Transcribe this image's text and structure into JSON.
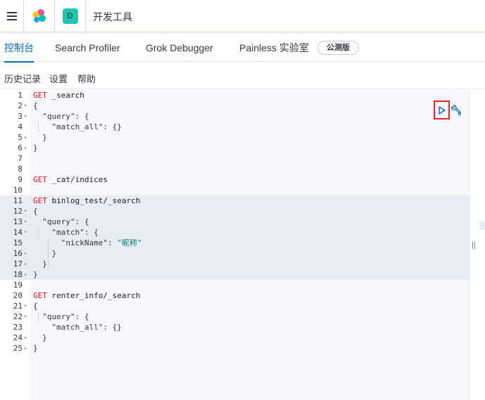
{
  "header": {
    "app_title": "开发工具",
    "space_initial": "D",
    "menu_icon": "hamburger-icon",
    "logo_icon": "elastic-logo-icon"
  },
  "tabs": [
    {
      "label": "控制台",
      "selected": true
    },
    {
      "label": "Search Profiler",
      "selected": false
    },
    {
      "label": "Grok Debugger",
      "selected": false
    },
    {
      "label": "Painless 实验室",
      "selected": false
    }
  ],
  "badge": "公测版",
  "submenu": [
    "历史记录",
    "设置",
    "帮助"
  ],
  "editor": {
    "line_numbers": [
      "1",
      "2",
      "3",
      "4",
      "5",
      "6",
      "7",
      "8",
      "9",
      "10",
      "11",
      "12",
      "13",
      "14",
      "15",
      "16",
      "17",
      "18",
      "19",
      "20",
      "21",
      "22",
      "23",
      "24",
      "25"
    ],
    "lines": [
      {
        "method": "GET",
        "rest": " _search"
      },
      {
        "text": "{"
      },
      {
        "key": "  \"query\"",
        "rest": ": {"
      },
      {
        "key": "    \"match_all\"",
        "rest": ": {}"
      },
      {
        "text": "  }"
      },
      {
        "text": "}"
      },
      {
        "text": ""
      },
      {
        "text": ""
      },
      {
        "method": "GET",
        "rest": " _cat/indices"
      },
      {
        "text": ""
      },
      {
        "method": "GET",
        "rest": " binlog_test/_search"
      },
      {
        "text": "{"
      },
      {
        "key": "  \"query\"",
        "rest": ": {"
      },
      {
        "key": "    \"match\"",
        "rest": ": {"
      },
      {
        "key": "      \"nickName\"",
        "rest": ": ",
        "str": "\"昵称\""
      },
      {
        "text": "    }"
      },
      {
        "text": "  }"
      },
      {
        "text": "}"
      },
      {
        "text": ""
      },
      {
        "method": "GET",
        "rest": " renter_info/_search"
      },
      {
        "text": "{"
      },
      {
        "key": "  \"query\"",
        "rest": ": {"
      },
      {
        "key": "    \"match_all\"",
        "rest": ": {}"
      },
      {
        "text": "  }"
      },
      {
        "text": "}"
      }
    ],
    "folds": {
      "2": "▾",
      "3": "▾",
      "5": "▴",
      "6": "▴",
      "12": "▾",
      "13": "▾",
      "14": "▾",
      "16": "▴",
      "17": "▴",
      "18": "▴",
      "21": "▾",
      "22": "▾",
      "24": "▴",
      "25": "▴"
    }
  },
  "actions": {
    "run_icon": "play-icon",
    "settings_icon": "wrench-icon",
    "run_color": "#006bb8",
    "highlight_color": "#e7232b"
  },
  "resizer_glyph": "||"
}
